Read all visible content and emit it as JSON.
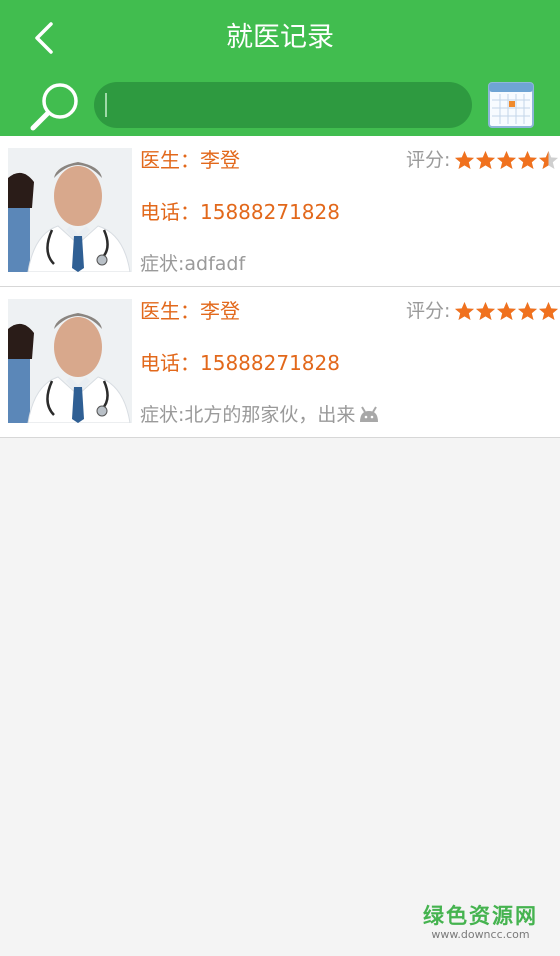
{
  "header": {
    "title": "就医记录",
    "back_icon": "back-arrow-icon",
    "search_icon": "search-icon",
    "calendar_icon": "calendar-icon",
    "search_value": "",
    "brand_color": "#41bd4f"
  },
  "records": [
    {
      "doctor": "医生：李登",
      "phone": "电话：15888271828",
      "symptom": "症状:adfadf",
      "rating_label": "评分:",
      "rating": 4.5
    },
    {
      "doctor": "医生：李登",
      "phone": "电话：15888271828",
      "symptom": "症状:北方的那家伙，出来",
      "rating_label": "评分:",
      "rating": 5
    }
  ],
  "watermark": {
    "title": "绿色资源网",
    "url": "www.downcc.com"
  }
}
